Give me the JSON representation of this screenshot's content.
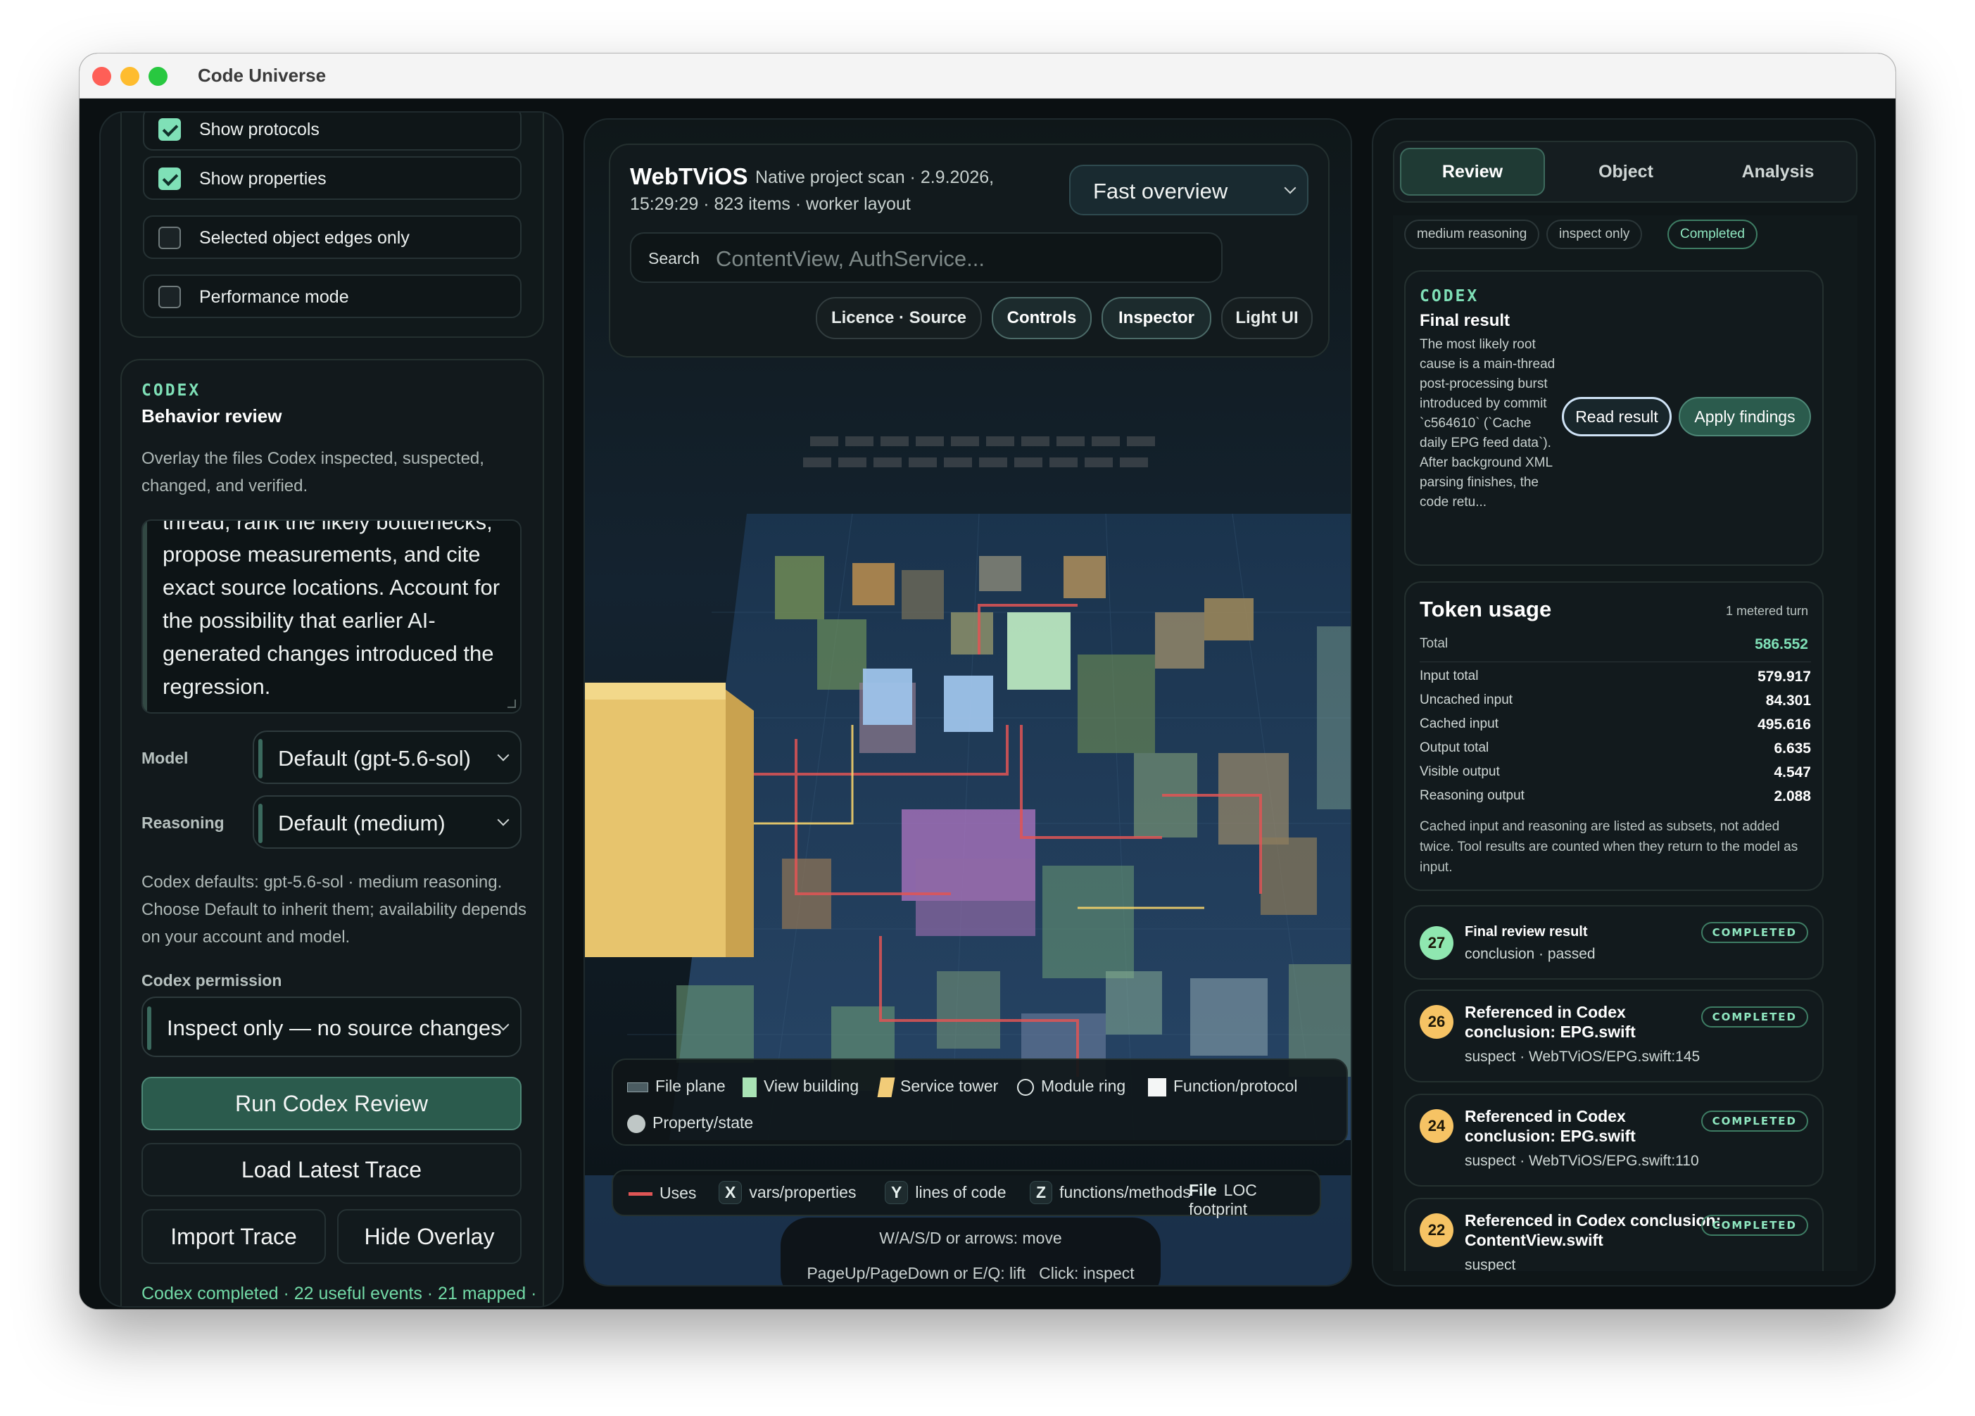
{
  "window": {
    "title": "Code Universe"
  },
  "left": {
    "toggles": [
      {
        "label": "Show protocols",
        "checked": true
      },
      {
        "label": "Show properties",
        "checked": true
      },
      {
        "label": "Selected object edges only",
        "checked": false
      },
      {
        "label": "Performance mode",
        "checked": false
      }
    ],
    "codex_tag": "CODEX",
    "review_title": "Behavior review",
    "review_desc": "Overlay the files Codex inspected, suspected, changed, and verified.",
    "prompt_partial": "thread, rank the likely bottlenecks,",
    "prompt_text": "propose measurements, and cite exact source locations. Account for the possibility that earlier AI-generated changes introduced the regression.",
    "model_label": "Model",
    "model_value": "Default (gpt-5.6-sol)",
    "reasoning_label": "Reasoning",
    "reasoning_value": "Default (medium)",
    "defaults_note": "Codex defaults: gpt-5.6-sol · medium reasoning. Choose Default to inherit them; availability depends on your account and model.",
    "permission_label": "Codex permission",
    "permission_value": "Inspect only — no source changes",
    "run_button": "Run Codex Review",
    "load_button": "Load Latest Trace",
    "import_button": "Import Trace",
    "hide_button": "Hide Overlay",
    "status": "Codex completed · 22 useful events · 21 mapped ·"
  },
  "center": {
    "project_name": "WebTViOS",
    "scan_info_1": "Native project scan · 2.9.2026,",
    "scan_info_2": "15:29:29 · 823 items · worker layout",
    "mode_value": "Fast overview",
    "search_label": "Search",
    "search_placeholder": "ContentView, AuthService...",
    "buttons": [
      "Licence · Source",
      "Controls",
      "Inspector",
      "Light UI"
    ],
    "legend": [
      "File plane",
      "View building",
      "Service tower",
      "Module ring",
      "Function/protocol",
      "Property/state"
    ],
    "axis_uses": "Uses",
    "axis_x_key": "X",
    "axis_x": "vars/properties",
    "axis_y_key": "Y",
    "axis_y": "lines of code",
    "axis_z_key": "Z",
    "axis_z": "functions/methods",
    "axis_file_key": "File",
    "axis_file": "LOC footprint",
    "help_1": "W/A/S/D or arrows: move",
    "help_2": "PageUp/PageDown or E/Q: lift",
    "help_3": "Click: inspect"
  },
  "right": {
    "tabs": [
      "Review",
      "Object",
      "Analysis"
    ],
    "chips": [
      "medium reasoning",
      "inspect only",
      "Completed"
    ],
    "codex_tag": "CODEX",
    "final_title": "Final result",
    "final_text": "The most likely root cause is a main-thread post-processing burst introduced by commit `c564610` (`Cache daily EPG feed data`). After background XML parsing finishes, the code retu...",
    "read_button": "Read result",
    "apply_button": "Apply findings",
    "token_title": "Token usage",
    "token_meta": "1 metered turn",
    "token_total_label": "Total",
    "token_total_value": "586.552",
    "token_rows": [
      {
        "k": "Input total",
        "v": "579.917"
      },
      {
        "k": "Uncached input",
        "v": "84.301"
      },
      {
        "k": "Cached input",
        "v": "495.616"
      },
      {
        "k": "Output total",
        "v": "6.635"
      },
      {
        "k": "Visible output",
        "v": "4.547"
      },
      {
        "k": "Reasoning output",
        "v": "2.088"
      }
    ],
    "token_note": "Cached input and reasoning are listed as subsets, not added twice. Tool results are counted when they return to the model as input.",
    "events": [
      {
        "num": "27",
        "title": "Final review result",
        "sub": "conclusion · passed",
        "badge": "COMPLETED"
      },
      {
        "num": "26",
        "title": "Referenced in Codex conclusion: EPG.swift",
        "sub": "suspect · WebTViOS/EPG.swift:145",
        "badge": "COMPLETED"
      },
      {
        "num": "24",
        "title": "Referenced in Codex conclusion: EPG.swift",
        "sub": "suspect · WebTViOS/EPG.swift:110",
        "badge": "COMPLETED"
      },
      {
        "num": "22",
        "title": "Referenced in Codex conclusion: ContentView.swift",
        "sub": "suspect",
        "badge": "COMPLETED"
      }
    ]
  }
}
